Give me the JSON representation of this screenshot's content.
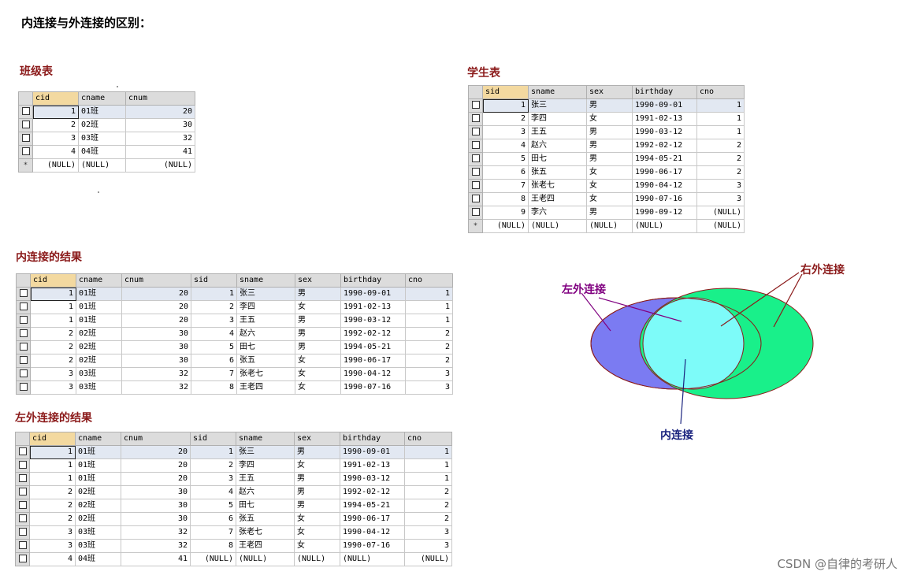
{
  "page_title": "内连接与外连接的区别：",
  "watermark": "CSDN @自律的考研人",
  "class_table": {
    "title": "班级表",
    "columns": [
      "cid",
      "cname",
      "cnum"
    ],
    "rows": [
      [
        "1",
        "01班",
        "20"
      ],
      [
        "2",
        "02班",
        "30"
      ],
      [
        "3",
        "03班",
        "32"
      ],
      [
        "4",
        "04班",
        "41"
      ]
    ],
    "new_row": [
      "(NULL)",
      "(NULL)",
      "(NULL)"
    ]
  },
  "student_table": {
    "title": "学生表",
    "columns": [
      "sid",
      "sname",
      "sex",
      "birthday",
      "cno"
    ],
    "rows": [
      [
        "1",
        "张三",
        "男",
        "1990-09-01",
        "1"
      ],
      [
        "2",
        "李四",
        "女",
        "1991-02-13",
        "1"
      ],
      [
        "3",
        "王五",
        "男",
        "1990-03-12",
        "1"
      ],
      [
        "4",
        "赵六",
        "男",
        "1992-02-12",
        "2"
      ],
      [
        "5",
        "田七",
        "男",
        "1994-05-21",
        "2"
      ],
      [
        "6",
        "张五",
        "女",
        "1990-06-17",
        "2"
      ],
      [
        "7",
        "张老七",
        "女",
        "1990-04-12",
        "3"
      ],
      [
        "8",
        "王老四",
        "女",
        "1990-07-16",
        "3"
      ],
      [
        "9",
        "李六",
        "男",
        "1990-09-12",
        "(NULL)"
      ]
    ],
    "new_row": [
      "(NULL)",
      "(NULL)",
      "(NULL)",
      "(NULL)",
      "(NULL)"
    ]
  },
  "inner_join": {
    "title": "内连接的结果",
    "columns": [
      "cid",
      "cname",
      "cnum",
      "sid",
      "sname",
      "sex",
      "birthday",
      "cno"
    ],
    "rows": [
      [
        "1",
        "01班",
        "20",
        "1",
        "张三",
        "男",
        "1990-09-01",
        "1"
      ],
      [
        "1",
        "01班",
        "20",
        "2",
        "李四",
        "女",
        "1991-02-13",
        "1"
      ],
      [
        "1",
        "01班",
        "20",
        "3",
        "王五",
        "男",
        "1990-03-12",
        "1"
      ],
      [
        "2",
        "02班",
        "30",
        "4",
        "赵六",
        "男",
        "1992-02-12",
        "2"
      ],
      [
        "2",
        "02班",
        "30",
        "5",
        "田七",
        "男",
        "1994-05-21",
        "2"
      ],
      [
        "2",
        "02班",
        "30",
        "6",
        "张五",
        "女",
        "1990-06-17",
        "2"
      ],
      [
        "3",
        "03班",
        "32",
        "7",
        "张老七",
        "女",
        "1990-04-12",
        "3"
      ],
      [
        "3",
        "03班",
        "32",
        "8",
        "王老四",
        "女",
        "1990-07-16",
        "3"
      ]
    ]
  },
  "left_join": {
    "title": "左外连接的结果",
    "columns": [
      "cid",
      "cname",
      "cnum",
      "sid",
      "sname",
      "sex",
      "birthday",
      "cno"
    ],
    "rows": [
      [
        "1",
        "01班",
        "20",
        "1",
        "张三",
        "男",
        "1990-09-01",
        "1"
      ],
      [
        "1",
        "01班",
        "20",
        "2",
        "李四",
        "女",
        "1991-02-13",
        "1"
      ],
      [
        "1",
        "01班",
        "20",
        "3",
        "王五",
        "男",
        "1990-03-12",
        "1"
      ],
      [
        "2",
        "02班",
        "30",
        "4",
        "赵六",
        "男",
        "1992-02-12",
        "2"
      ],
      [
        "2",
        "02班",
        "30",
        "5",
        "田七",
        "男",
        "1994-05-21",
        "2"
      ],
      [
        "2",
        "02班",
        "30",
        "6",
        "张五",
        "女",
        "1990-06-17",
        "2"
      ],
      [
        "3",
        "03班",
        "32",
        "7",
        "张老七",
        "女",
        "1990-04-12",
        "3"
      ],
      [
        "3",
        "03班",
        "32",
        "8",
        "王老四",
        "女",
        "1990-07-16",
        "3"
      ],
      [
        "4",
        "04班",
        "41",
        "(NULL)",
        "(NULL)",
        "(NULL)",
        "(NULL)",
        "(NULL)"
      ]
    ]
  },
  "venn": {
    "left_label": "左外连接",
    "right_label": "右外连接",
    "inner_label": "内连接",
    "colors": {
      "left": "#7b7bf2",
      "right": "#19f08a",
      "inner": "#7dfbf9",
      "outline": "#8b1a1a",
      "left_label": "#800080",
      "right_label": "#8b1a1a",
      "inner_label": "#1a237e"
    }
  }
}
